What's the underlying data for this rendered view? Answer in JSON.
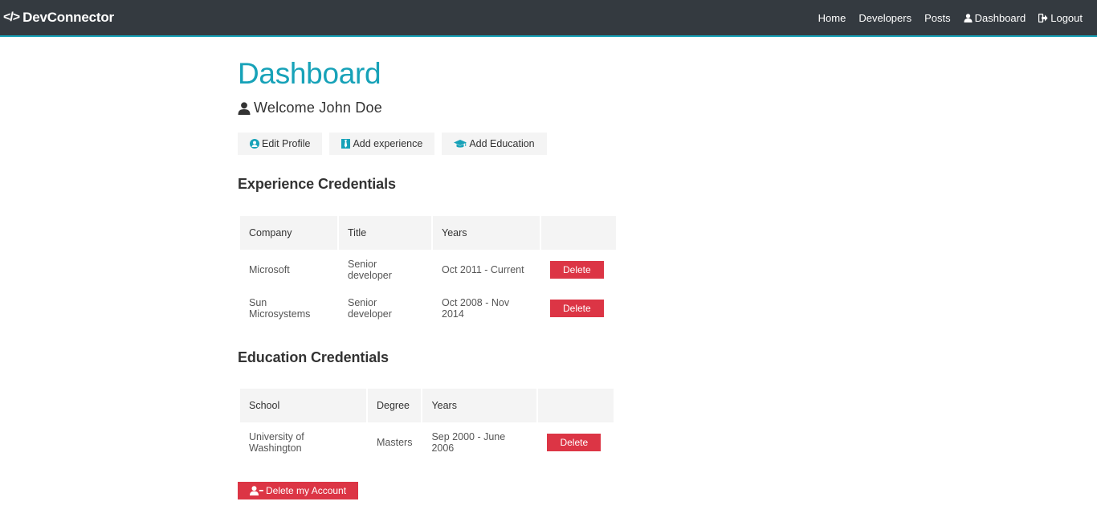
{
  "navbar": {
    "brand_icon": "</>",
    "brand": "DevConnector",
    "links": {
      "home": "Home",
      "developers": "Developers",
      "posts": "Posts",
      "dashboard": "Dashboard",
      "logout": "Logout"
    }
  },
  "page": {
    "title": "Dashboard",
    "welcome": "Welcome John Doe"
  },
  "actions": {
    "edit_profile": "Edit Profile",
    "add_experience": "Add experience",
    "add_education": "Add Education"
  },
  "experience": {
    "title": "Experience Credentials",
    "headers": [
      "Company",
      "Title",
      "Years",
      ""
    ],
    "rows": [
      {
        "company": "Microsoft",
        "title": "Senior developer",
        "years": "Oct 2011 - Current",
        "action": "Delete"
      },
      {
        "company": "Sun Microsystems",
        "title": "Senior developer",
        "years": "Oct 2008 - Nov 2014",
        "action": "Delete"
      }
    ]
  },
  "education": {
    "title": "Education Credentials",
    "headers": [
      "School",
      "Degree",
      "Years",
      ""
    ],
    "rows": [
      {
        "school": "University of Washington",
        "degree": "Masters",
        "years": "Sep 2000 - June 2006",
        "action": "Delete"
      }
    ]
  },
  "delete_account": "Delete my Account",
  "colors": {
    "primary": "#17a2b8",
    "dark": "#343a40",
    "danger": "#dc3545",
    "light": "#f4f4f4"
  },
  "icons": {
    "brand": "code-icon",
    "dashboard": "user-icon",
    "logout": "sign-out-icon",
    "welcome": "user-icon",
    "edit_profile": "user-circle-icon",
    "add_experience": "black-tie-icon",
    "add_education": "graduation-cap-icon",
    "delete_account": "user-minus-icon"
  }
}
